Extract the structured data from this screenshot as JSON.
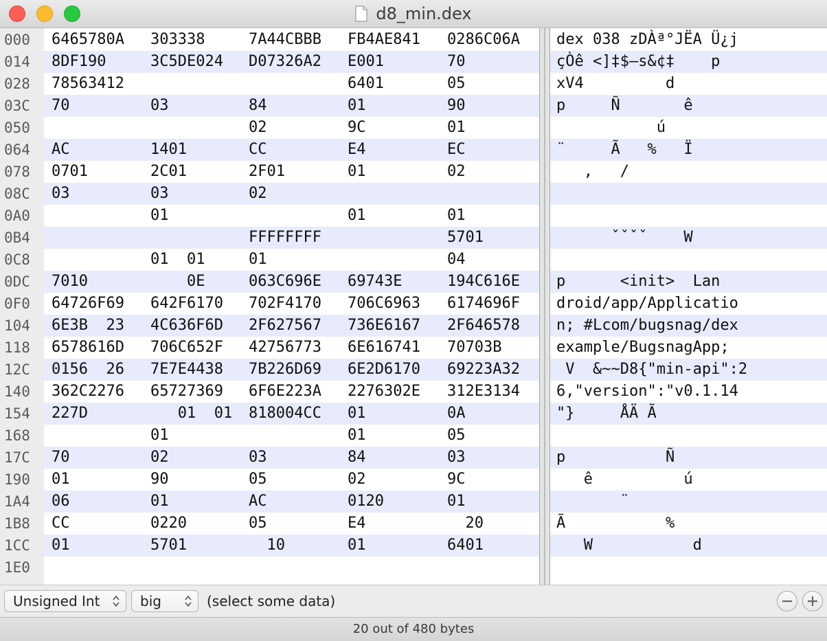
{
  "window": {
    "title": "d8_min.dex"
  },
  "offsets": [
    "000",
    "014",
    "028",
    "03C",
    "050",
    "064",
    "078",
    "08C",
    "0A0",
    "0B4",
    "0C8",
    "0DC",
    "0F0",
    "104",
    "118",
    "12C",
    "140",
    "154",
    "168",
    "17C",
    "190",
    "1A4",
    "1B8",
    "1CC",
    "1E0"
  ],
  "hex_rows": [
    [
      "6465780A",
      "303338",
      "7A44CBBB",
      "FB4AE841",
      "0286C06A"
    ],
    [
      "8DF190",
      "3C5DE024",
      "D07326A2",
      "E001",
      "70"
    ],
    [
      "78563412",
      "",
      "",
      "6401",
      "05"
    ],
    [
      "70",
      "03",
      "84",
      "01",
      "90"
    ],
    [
      "",
      "",
      "02",
      "9C",
      "01"
    ],
    [
      "AC",
      "1401",
      "CC",
      "E4",
      "EC"
    ],
    [
      "0701",
      "2C01",
      "2F01",
      "01",
      "02"
    ],
    [
      "03",
      "03",
      "02",
      "",
      ""
    ],
    [
      "",
      "01",
      "",
      "01",
      "01"
    ],
    [
      "",
      "",
      "FFFFFFFF",
      "",
      "5701"
    ],
    [
      "",
      "01  01",
      "01",
      "",
      "04"
    ],
    [
      "7010",
      "    0E",
      "063C696E",
      "69743E",
      "194C616E"
    ],
    [
      "64726F69",
      "642F6170",
      "702F4170",
      "706C6963",
      "6174696F"
    ],
    [
      "6E3B  23",
      "4C636F6D",
      "2F627567",
      "736E6167",
      "2F646578"
    ],
    [
      "6578616D",
      "706C652F",
      "42756773",
      "6E616741",
      "70703B"
    ],
    [
      "0156  26",
      "7E7E4438",
      "7B226D69",
      "6E2D6170",
      "69223A32"
    ],
    [
      "362C2276",
      "65727369",
      "6F6E223A",
      "2276302E",
      "312E3134"
    ],
    [
      "227D",
      "   01  01",
      "818004CC",
      "01",
      "0A"
    ],
    [
      "",
      "01",
      "",
      "01",
      "05"
    ],
    [
      "70",
      "02",
      "03",
      "84",
      "03"
    ],
    [
      "01",
      "90",
      "05",
      "02",
      "9C"
    ],
    [
      "06",
      "01",
      "AC",
      "0120",
      "01"
    ],
    [
      "CC",
      "0220",
      "05",
      "E4",
      "  20"
    ],
    [
      "01",
      "5701",
      "  10",
      "01",
      "6401"
    ]
  ],
  "ascii_rows": [
    "dex 038 zDÀª°JËA Ü¿j",
    "çÒê <]‡$–s&¢‡    p",
    "xV4         d",
    "p     Ñ       ê",
    "           ú",
    "¨     Ã   %   Ï",
    "   ,   /",
    "",
    "",
    "      ˇˇˇˇ    W",
    "",
    "p      <init>  Lan",
    "droid/app/Applicatio",
    "n; #Lcom/bugsnag/dex",
    "example/BugsnagApp;",
    " V  &~~D8{\"min-api\":2",
    "6,\"version\":\"v0.1.14",
    "\"}     ÅÄ Ã",
    "",
    "p           Ñ",
    "   ê          ú",
    "       ¨",
    "Ã           %",
    "   W           d"
  ],
  "status": {
    "type_select": "Unsigned Int",
    "endian_select": "big",
    "message": "(select some data)",
    "byte_count": "20 out of 480 bytes"
  },
  "icons": {
    "minus": "minus-icon",
    "plus": "plus-icon",
    "document": "document-icon"
  }
}
